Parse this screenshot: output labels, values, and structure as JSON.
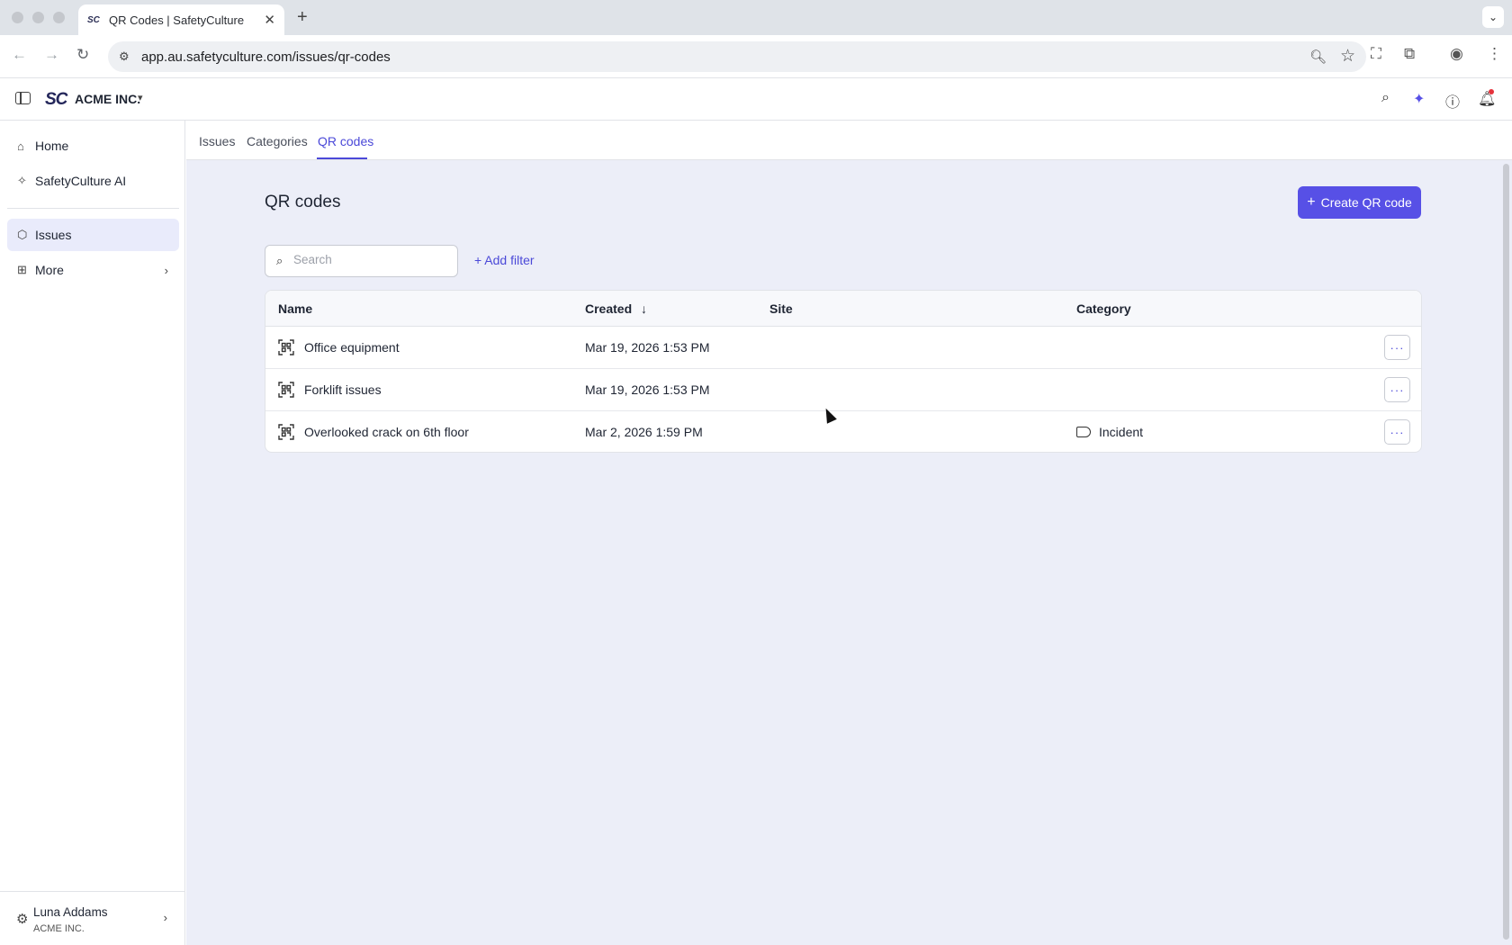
{
  "browser": {
    "tab_title": "QR Codes | SafetyCulture",
    "tab_favicon": "SC",
    "tab_close": "✕",
    "new_tab": "+",
    "tab_menu": "⌄",
    "url": "app.au.safetyculture.com/issues/qr-codes"
  },
  "header": {
    "logo": "SC",
    "org_name": "ACME INC.",
    "icons": [
      "search-icon",
      "ai-sparkle-icon",
      "help-icon",
      "notifications-icon"
    ]
  },
  "sidebar": {
    "items": [
      {
        "label": "Home",
        "icon": "home-icon"
      },
      {
        "label": "SafetyCulture AI",
        "icon": "sparkle-icon"
      },
      {
        "label": "Issues",
        "icon": "issues-icon",
        "active": true
      },
      {
        "label": "More",
        "icon": "grid-icon"
      }
    ],
    "user": {
      "name": "Luna Addams",
      "org": "ACME INC."
    }
  },
  "subtabs": {
    "items": [
      "Issues",
      "Categories",
      "QR codes"
    ],
    "active": "QR codes"
  },
  "page": {
    "title": "QR codes",
    "create_button": "Create QR code",
    "search_placeholder": "Search",
    "add_filter": "Add filter"
  },
  "table": {
    "columns": [
      "Name",
      "Created",
      "Site",
      "Category"
    ],
    "sort_indicator": "↓",
    "rows": [
      {
        "name": "Office equipment",
        "created": "Mar 19, 2026 1:53 PM",
        "site": "",
        "category": ""
      },
      {
        "name": "Forklift issues",
        "created": "Mar 19, 2026 1:53 PM",
        "site": "",
        "category": ""
      },
      {
        "name": "Overlooked crack on 6th floor",
        "created": "Mar 2, 2026 1:59 PM",
        "site": "",
        "category": "Incident"
      }
    ],
    "row_action": "···"
  },
  "colors": {
    "accent": "#5750e6",
    "active_nav_bg": "#e9ebfb",
    "main_bg": "#eceef8"
  }
}
